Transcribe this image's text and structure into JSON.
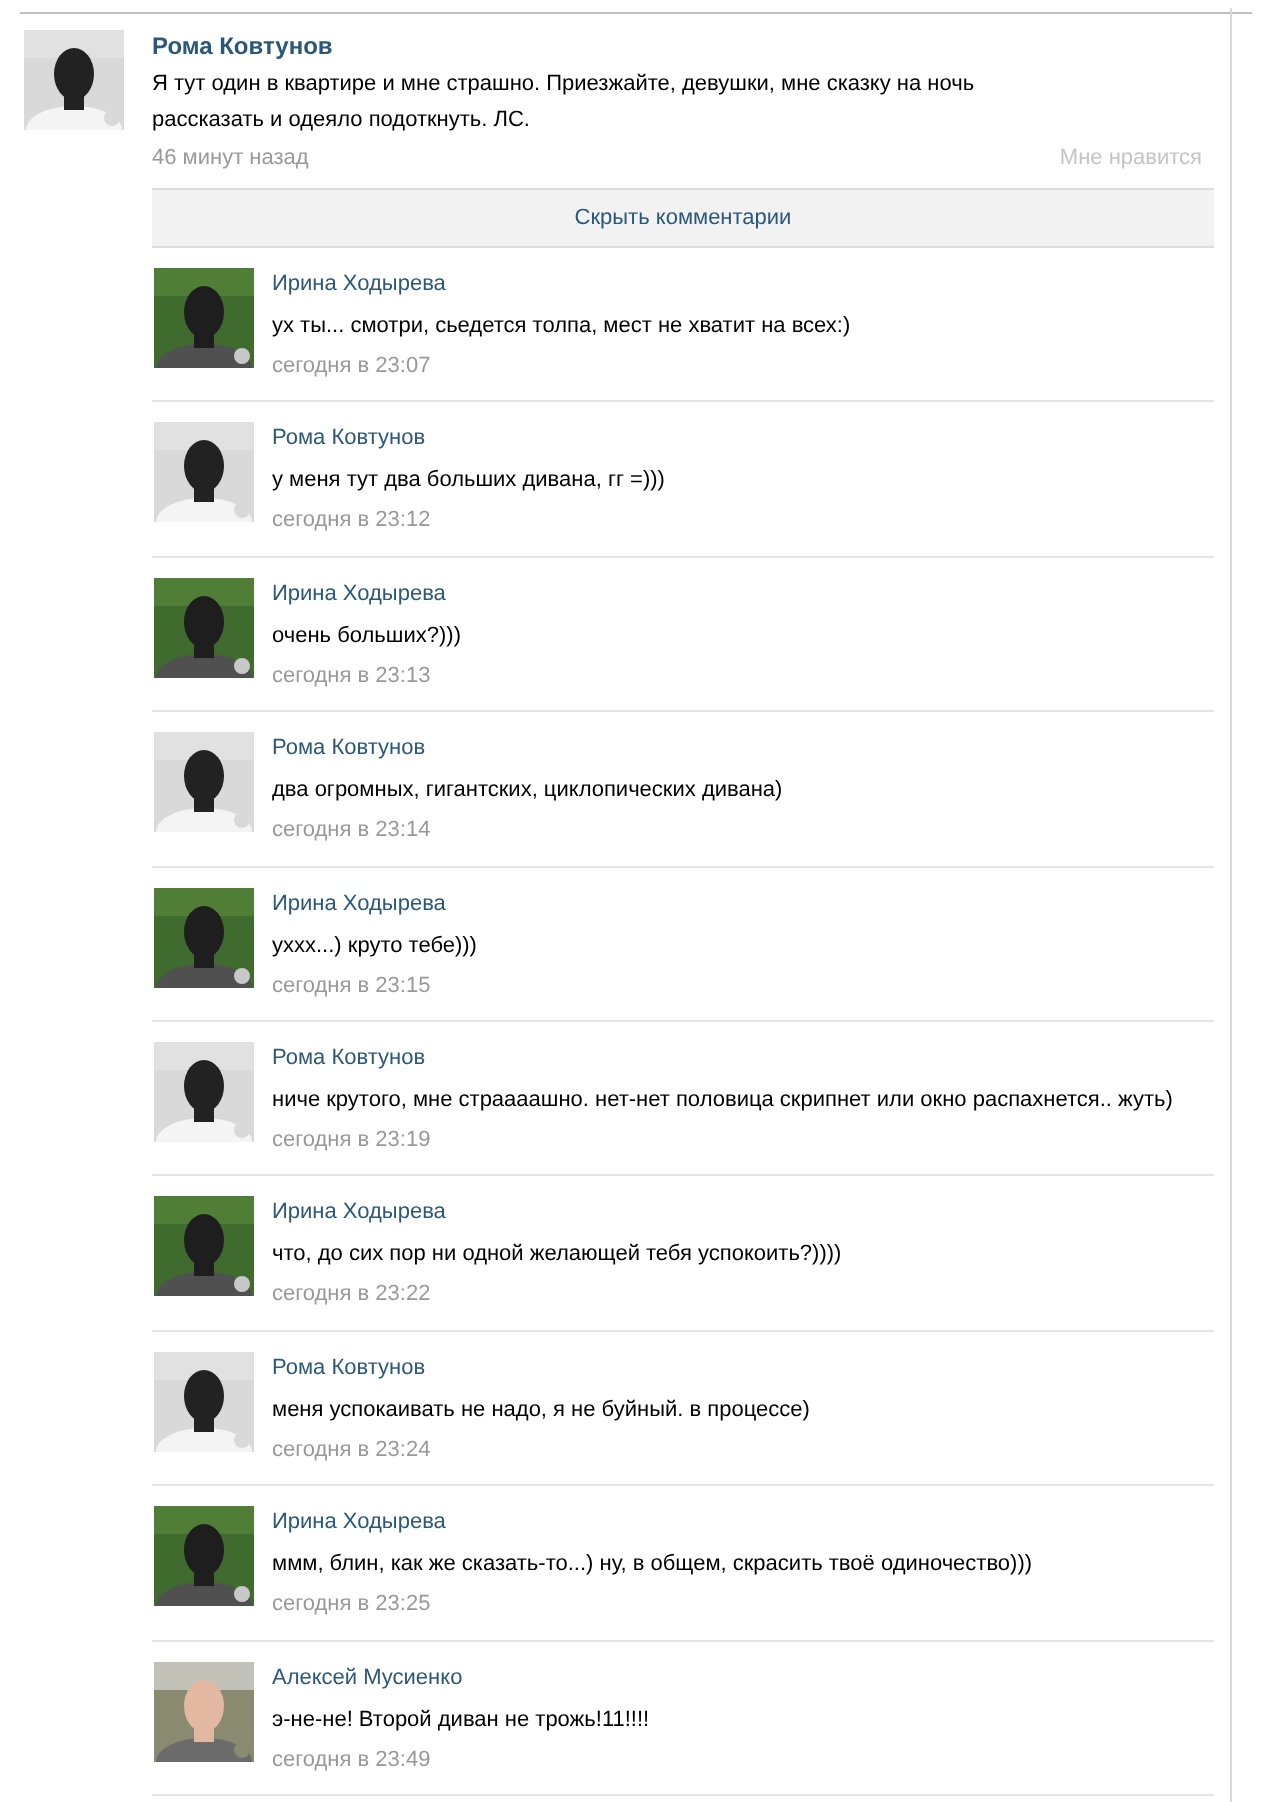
{
  "post": {
    "author": "Рома Ковтунов",
    "text": "Я тут один в квартире и мне страшно. Приезжайте, девушки, мне сказку на ночь рассказать и одеяло подоткнуть. ЛС.",
    "time": "46 минут назад",
    "like_label": "Мне нравится"
  },
  "hide_comments": "Скрыть комментарии",
  "comments": [
    {
      "author": "Ирина Ходырева",
      "text": "ух ты... смотри, сьедется толпа, мест не хватит на всех:)",
      "time": "сегодня в 23:07"
    },
    {
      "author": "Рома Ковтунов",
      "text": "у меня тут два больших дивана, гг =)))",
      "time": "сегодня в 23:12"
    },
    {
      "author": "Ирина Ходырева",
      "text": "очень больших?)))",
      "time": "сегодня в 23:13"
    },
    {
      "author": "Рома Ковтунов",
      "text": "два огромных, гигантских, циклопических дивана)",
      "time": "сегодня в 23:14"
    },
    {
      "author": "Ирина Ходырева",
      "text": "уххх...) круто тебе)))",
      "time": "сегодня в 23:15"
    },
    {
      "author": "Рома Ковтунов",
      "text": "ниче крутого, мне страааашно. нет-нет половица скрипнет или окно распахнется.. жуть)",
      "time": "сегодня в 23:19"
    },
    {
      "author": "Ирина Ходырева",
      "text": "что, до сих пор ни одной желающей тебя успокоить?))))",
      "time": "сегодня в 23:22"
    },
    {
      "author": "Рома Ковтунов",
      "text": "меня успокаивать не надо, я не буйный. в процессе)",
      "time": "сегодня в 23:24"
    },
    {
      "author": "Ирина Ходырева",
      "text": "ммм, блин, как же сказать-то...) ну, в общем, скрасить твоё одиночество)))",
      "time": "сегодня в 23:25"
    },
    {
      "author": "Алексей Мусиенко",
      "text": "э-не-не! Второй диван не трожь!11!!!!",
      "time": "сегодня в 23:49"
    }
  ]
}
